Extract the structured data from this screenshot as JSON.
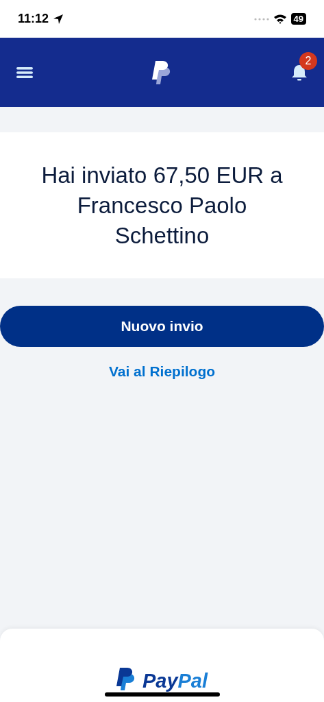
{
  "status_bar": {
    "time": "11:12",
    "battery": "49"
  },
  "header": {
    "notifications": {
      "count": "2"
    }
  },
  "confirmation": {
    "message": "Hai inviato 67,50 EUR a Francesco Paolo Schettino"
  },
  "actions": {
    "primary": "Nuovo invio",
    "link": "Vai al Riepilogo"
  },
  "footer": {
    "wordmark": [
      "Pay",
      "Pal"
    ]
  }
}
